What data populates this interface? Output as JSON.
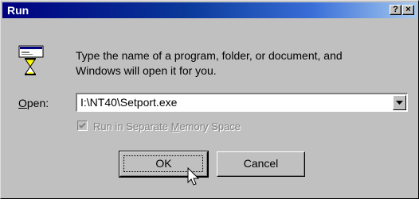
{
  "window": {
    "title": "Run",
    "help_button": "?",
    "close_button": "×"
  },
  "dialog": {
    "icon": "run-hourglass-icon",
    "description_line1": "Type the name of a program, folder, or document, and",
    "description_line2": "Windows will open it for you.",
    "open_label_prefix": "O",
    "open_label_rest": "pen:",
    "open_value": "I:\\NT40\\Setport.exe",
    "checkbox": {
      "label_before": "Run in Separate ",
      "label_ul": "M",
      "label_after": "emory Space",
      "checked": true,
      "enabled": false
    },
    "ok_label": "OK",
    "cancel_label": "Cancel"
  },
  "colors": {
    "face": "#c0c0c0",
    "titlebar_start": "#000080",
    "titlebar_end": "#a6caf0",
    "disabled_text": "#808080"
  }
}
